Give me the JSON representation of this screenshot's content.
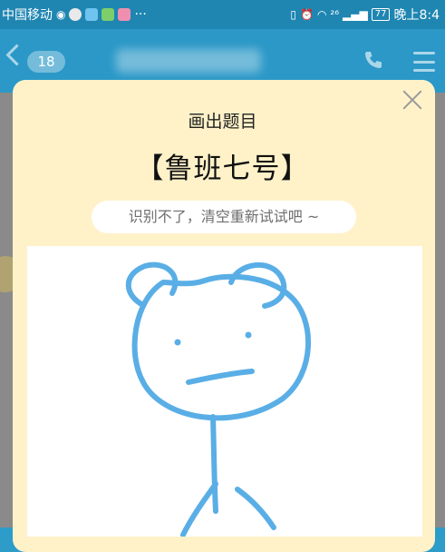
{
  "status_bar": {
    "carrier": "中国移动",
    "more": "···",
    "network": "²⁶",
    "battery": "77",
    "time": "晚上8:4"
  },
  "header": {
    "unread_count": "18"
  },
  "dialog": {
    "title": "画出题目",
    "word": "【鲁班七号】",
    "hint": "识别不了，清空重新试试吧 ~"
  },
  "colors": {
    "accent": "#2b98c7",
    "modal_bg": "#fff2c9",
    "stroke": "#5aaee6"
  }
}
